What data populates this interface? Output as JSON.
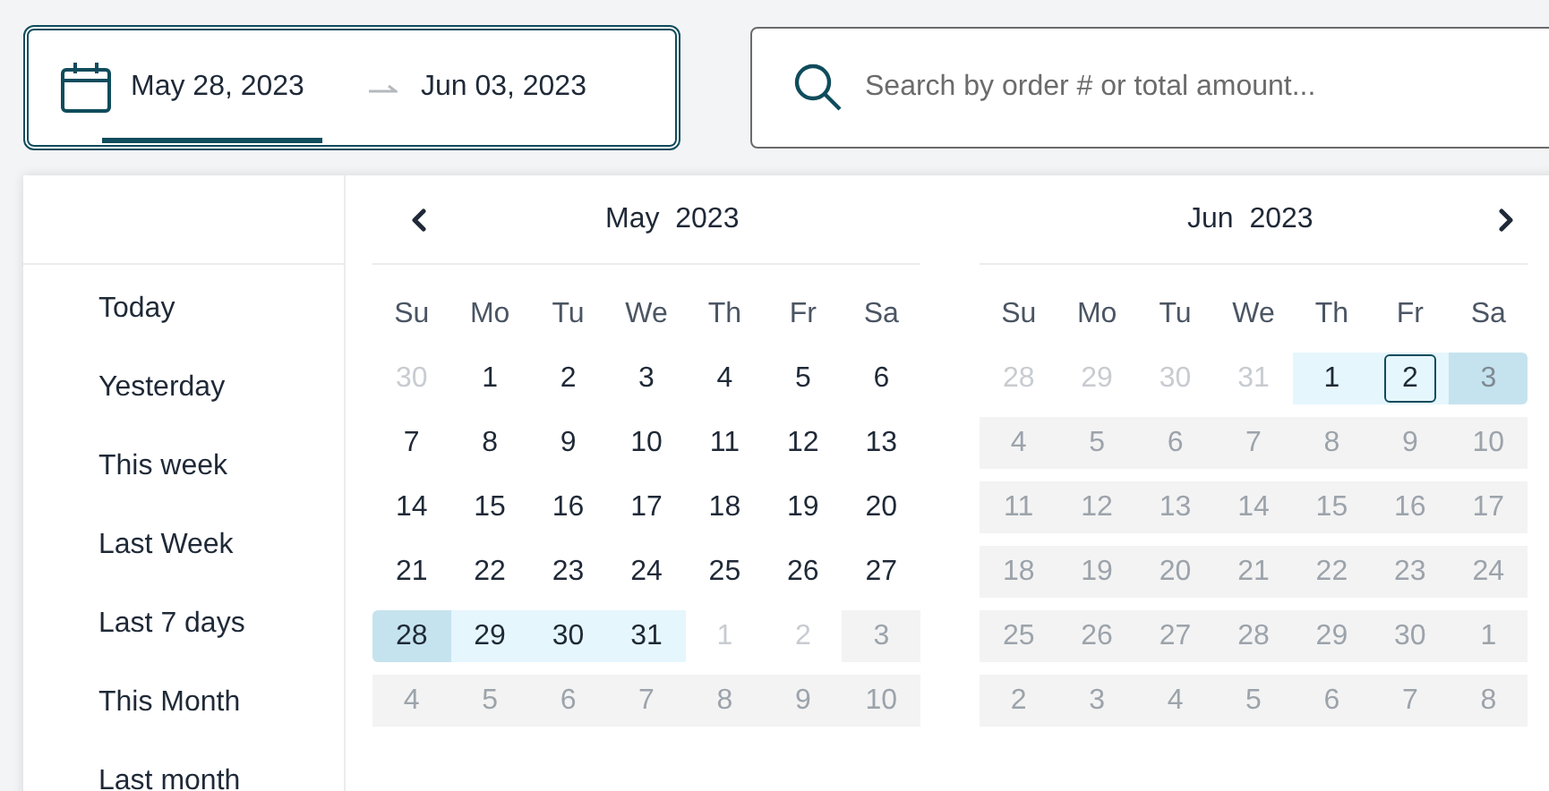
{
  "date_range": {
    "start": {
      "text": "May 28, 2023",
      "focused": true
    },
    "end": {
      "text": "Jun 03, 2023",
      "focused": false
    }
  },
  "search": {
    "placeholder": "Search by order # or total amount..."
  },
  "presets": [
    {
      "label": "Today"
    },
    {
      "label": "Yesterday"
    },
    {
      "label": "This week"
    },
    {
      "label": "Last Week"
    },
    {
      "label": "Last 7 days"
    },
    {
      "label": "This Month"
    },
    {
      "label": "Last month"
    }
  ],
  "months": [
    {
      "title": "May  2023",
      "weekdays": [
        "Su",
        "Mo",
        "Tu",
        "We",
        "Th",
        "Fr",
        "Sa"
      ],
      "days": [
        {
          "text": "30",
          "kind": "outside"
        },
        {
          "text": "1",
          "kind": "day"
        },
        {
          "text": "2",
          "kind": "day"
        },
        {
          "text": "3",
          "kind": "day"
        },
        {
          "text": "4",
          "kind": "day"
        },
        {
          "text": "5",
          "kind": "day"
        },
        {
          "text": "6",
          "kind": "day"
        },
        {
          "text": "7",
          "kind": "day"
        },
        {
          "text": "8",
          "kind": "day"
        },
        {
          "text": "9",
          "kind": "day"
        },
        {
          "text": "10",
          "kind": "day"
        },
        {
          "text": "11",
          "kind": "day"
        },
        {
          "text": "12",
          "kind": "day"
        },
        {
          "text": "13",
          "kind": "day"
        },
        {
          "text": "14",
          "kind": "day"
        },
        {
          "text": "15",
          "kind": "day"
        },
        {
          "text": "16",
          "kind": "day"
        },
        {
          "text": "17",
          "kind": "day"
        },
        {
          "text": "18",
          "kind": "day"
        },
        {
          "text": "19",
          "kind": "day"
        },
        {
          "text": "20",
          "kind": "day"
        },
        {
          "text": "21",
          "kind": "day"
        },
        {
          "text": "22",
          "kind": "day"
        },
        {
          "text": "23",
          "kind": "day"
        },
        {
          "text": "24",
          "kind": "day"
        },
        {
          "text": "25",
          "kind": "day"
        },
        {
          "text": "26",
          "kind": "day"
        },
        {
          "text": "27",
          "kind": "day"
        },
        {
          "text": "28",
          "kind": "range-edge"
        },
        {
          "text": "29",
          "kind": "range"
        },
        {
          "text": "30",
          "kind": "range"
        },
        {
          "text": "31",
          "kind": "range"
        },
        {
          "text": "1",
          "kind": "outside"
        },
        {
          "text": "2",
          "kind": "outside"
        },
        {
          "text": "3",
          "kind": "blocked"
        },
        {
          "text": "4",
          "kind": "blocked"
        },
        {
          "text": "5",
          "kind": "blocked"
        },
        {
          "text": "6",
          "kind": "blocked"
        },
        {
          "text": "7",
          "kind": "blocked"
        },
        {
          "text": "8",
          "kind": "blocked"
        },
        {
          "text": "9",
          "kind": "blocked"
        },
        {
          "text": "10",
          "kind": "blocked"
        }
      ]
    },
    {
      "title": "Jun  2023",
      "weekdays": [
        "Su",
        "Mo",
        "Tu",
        "We",
        "Th",
        "Fr",
        "Sa"
      ],
      "days": [
        {
          "text": "28",
          "kind": "outside"
        },
        {
          "text": "29",
          "kind": "outside"
        },
        {
          "text": "30",
          "kind": "outside"
        },
        {
          "text": "31",
          "kind": "outside"
        },
        {
          "text": "1",
          "kind": "range"
        },
        {
          "text": "2",
          "kind": "range-current"
        },
        {
          "text": "3",
          "kind": "range-edge-blocked"
        },
        {
          "text": "4",
          "kind": "blocked"
        },
        {
          "text": "5",
          "kind": "blocked"
        },
        {
          "text": "6",
          "kind": "blocked"
        },
        {
          "text": "7",
          "kind": "blocked"
        },
        {
          "text": "8",
          "kind": "blocked"
        },
        {
          "text": "9",
          "kind": "blocked"
        },
        {
          "text": "10",
          "kind": "blocked"
        },
        {
          "text": "11",
          "kind": "blocked"
        },
        {
          "text": "12",
          "kind": "blocked"
        },
        {
          "text": "13",
          "kind": "blocked"
        },
        {
          "text": "14",
          "kind": "blocked"
        },
        {
          "text": "15",
          "kind": "blocked"
        },
        {
          "text": "16",
          "kind": "blocked"
        },
        {
          "text": "17",
          "kind": "blocked"
        },
        {
          "text": "18",
          "kind": "blocked"
        },
        {
          "text": "19",
          "kind": "blocked"
        },
        {
          "text": "20",
          "kind": "blocked"
        },
        {
          "text": "21",
          "kind": "blocked"
        },
        {
          "text": "22",
          "kind": "blocked"
        },
        {
          "text": "23",
          "kind": "blocked"
        },
        {
          "text": "24",
          "kind": "blocked"
        },
        {
          "text": "25",
          "kind": "blocked"
        },
        {
          "text": "26",
          "kind": "blocked"
        },
        {
          "text": "27",
          "kind": "blocked"
        },
        {
          "text": "28",
          "kind": "blocked"
        },
        {
          "text": "29",
          "kind": "blocked"
        },
        {
          "text": "30",
          "kind": "blocked"
        },
        {
          "text": "1",
          "kind": "blocked"
        },
        {
          "text": "2",
          "kind": "blocked"
        },
        {
          "text": "3",
          "kind": "blocked"
        },
        {
          "text": "4",
          "kind": "blocked"
        },
        {
          "text": "5",
          "kind": "blocked"
        },
        {
          "text": "6",
          "kind": "blocked"
        },
        {
          "text": "7",
          "kind": "blocked"
        },
        {
          "text": "8",
          "kind": "blocked"
        }
      ]
    }
  ]
}
